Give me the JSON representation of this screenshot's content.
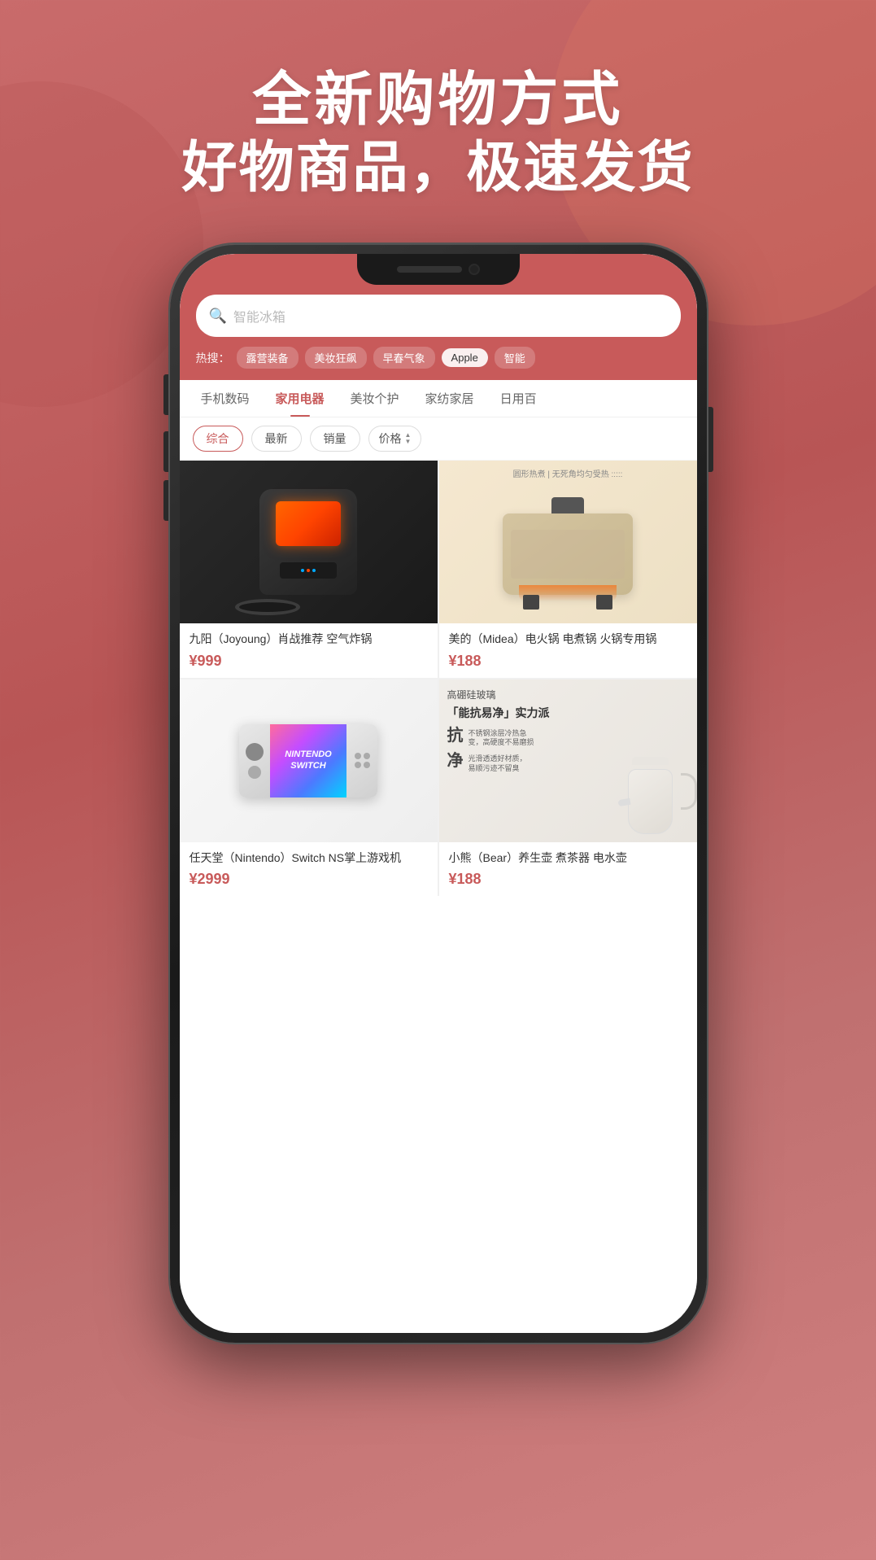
{
  "background": {
    "gradient_start": "#c96b6b",
    "gradient_end": "#b85555"
  },
  "header": {
    "line1": "全新购物方式",
    "line2": "好物商品，极速发货"
  },
  "app": {
    "search": {
      "placeholder": "智能冰箱",
      "add_btn": "+"
    },
    "hot_search": {
      "label": "热搜：",
      "tags": [
        "露营装备",
        "美妆狂飙",
        "早春气象",
        "Apple",
        "智能"
      ]
    },
    "categories": [
      {
        "label": "手机数码",
        "active": false
      },
      {
        "label": "家用电器",
        "active": true
      },
      {
        "label": "美妆个护",
        "active": false
      },
      {
        "label": "家纺家居",
        "active": false
      },
      {
        "label": "日用百",
        "active": false
      }
    ],
    "filters": [
      {
        "label": "综合",
        "active": true
      },
      {
        "label": "最新",
        "active": false
      },
      {
        "label": "销量",
        "active": false
      },
      {
        "label": "价格",
        "active": false,
        "has_arrows": true
      }
    ],
    "products": [
      {
        "id": "airfryer",
        "title": "九阳（Joyoung）肖战推荐 空气炸锅",
        "price": "¥999",
        "image_type": "airfryer"
      },
      {
        "id": "pan",
        "title": "美的（Midea）电火锅 电煮锅 火锅专用锅",
        "price": "¥188",
        "image_type": "pan"
      },
      {
        "id": "switch",
        "title": "任天堂（Nintendo）Switch NS掌上游戏机",
        "price": "¥2999",
        "image_type": "switch"
      },
      {
        "id": "kettle",
        "title": "小熊（Bear）养生壶 煮茶器 电水壶",
        "price": "¥188",
        "image_type": "kettle",
        "badge": "高硼硅玻璃",
        "slogan": "「能抗易净」实力派",
        "feature1_label": "抗",
        "feature1_text": "不锈钢涂层冷热急变，高硬度不易磨损",
        "feature2_label": "净",
        "feature2_text": "光滑透透好材质，易顺污迹不留臭"
      }
    ]
  }
}
